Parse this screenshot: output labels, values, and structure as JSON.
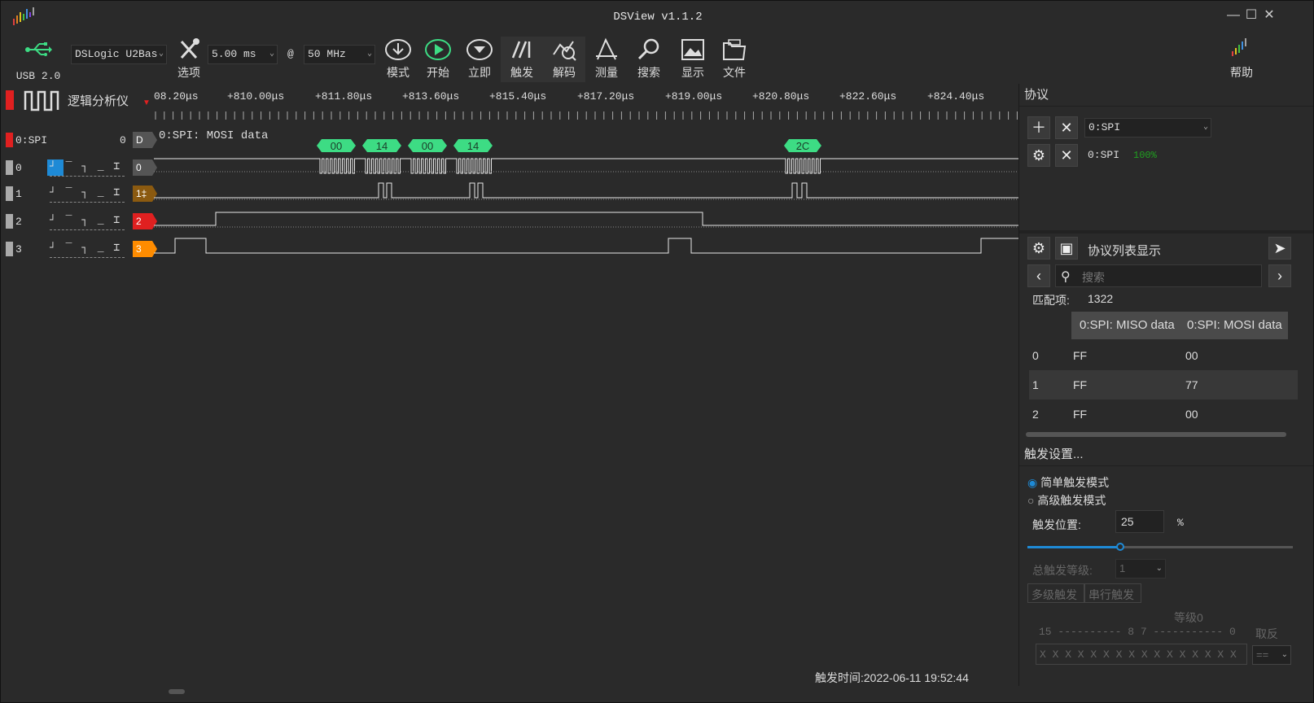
{
  "window": {
    "title": "DSView v1.1.2",
    "min_label": "—",
    "max_label": "☐",
    "close_label": "✕"
  },
  "toolbar": {
    "usb_label": "USB 2.0",
    "device": "DSLogic U2Bas",
    "options_label": "选项",
    "duration": "5.00 ms",
    "at": "@",
    "rate": "50 MHz",
    "mode_label": "模式",
    "start_label": "开始",
    "instant_label": "立即",
    "trigger_label": "触发",
    "decode_label": "解码",
    "measure_label": "测量",
    "search_label": "搜索",
    "display_label": "显示",
    "file_label": "文件",
    "help_label": "帮助"
  },
  "analyzer": {
    "mode_label": "逻辑分析仪"
  },
  "ruler": {
    "labels": [
      "08.20μs",
      "+810.00μs",
      "+811.80μs",
      "+813.60μs",
      "+815.40μs",
      "+817.20μs",
      "+819.00μs",
      "+820.80μs",
      "+822.60μs",
      "+824.40μs"
    ]
  },
  "channels": {
    "spi": {
      "name": "0:SPI",
      "count": "0",
      "tag": "D",
      "decode_label": "0:SPI: MOSI data"
    },
    "ch0": {
      "num": "0",
      "tag": "0"
    },
    "ch1": {
      "num": "1",
      "tag": "1‡"
    },
    "ch2": {
      "num": "2",
      "tag": "2"
    },
    "ch3": {
      "num": "3",
      "tag": "3"
    },
    "trigger_icons": "┘ ‾ ┐ _ ⌶"
  },
  "decode_bytes": [
    "00",
    "14",
    "00",
    "14",
    "2C"
  ],
  "protocol": {
    "header": "协议",
    "decoder_select": "0:SPI",
    "decoder_name": "0:SPI",
    "decoder_progress": "100%",
    "list_title": "协议列表显示",
    "search_placeholder": "搜索",
    "match_label": "匹配项:",
    "match_count": "1322",
    "columns": [
      "0:SPI: MISO data",
      "0:SPI: MOSI data"
    ],
    "rows": [
      {
        "idx": "0",
        "miso": "FF",
        "mosi": "00"
      },
      {
        "idx": "1",
        "miso": "FF",
        "mosi": "77"
      },
      {
        "idx": "2",
        "miso": "FF",
        "mosi": "00"
      }
    ]
  },
  "trigger": {
    "header": "触发设置...",
    "simple_mode": "简单触发模式",
    "advanced_mode": "高级触发模式",
    "position_label": "触发位置:",
    "position_value": "25",
    "position_unit": "%",
    "position_fraction": 0.25,
    "total_levels_label": "总触发等级:",
    "total_levels_value": "1",
    "tab_multi": "多级触发",
    "tab_serial": "串行触发",
    "level_label": "等级0",
    "bit_scale": "15 ---------- 8 7 ----------- 0",
    "invert_label": "取反",
    "pattern": "X X X X X X X X X X X X X X X X",
    "compare": "=="
  },
  "status": {
    "trigger_time": "触发时间:2022-06-11 19:52:44"
  },
  "colors": {
    "bg": "#2a2a2a",
    "green": "#3ddc84",
    "red": "#e02020",
    "orange": "#ff8c00",
    "brown": "#8b5a10",
    "blue": "#1e8ad6"
  }
}
